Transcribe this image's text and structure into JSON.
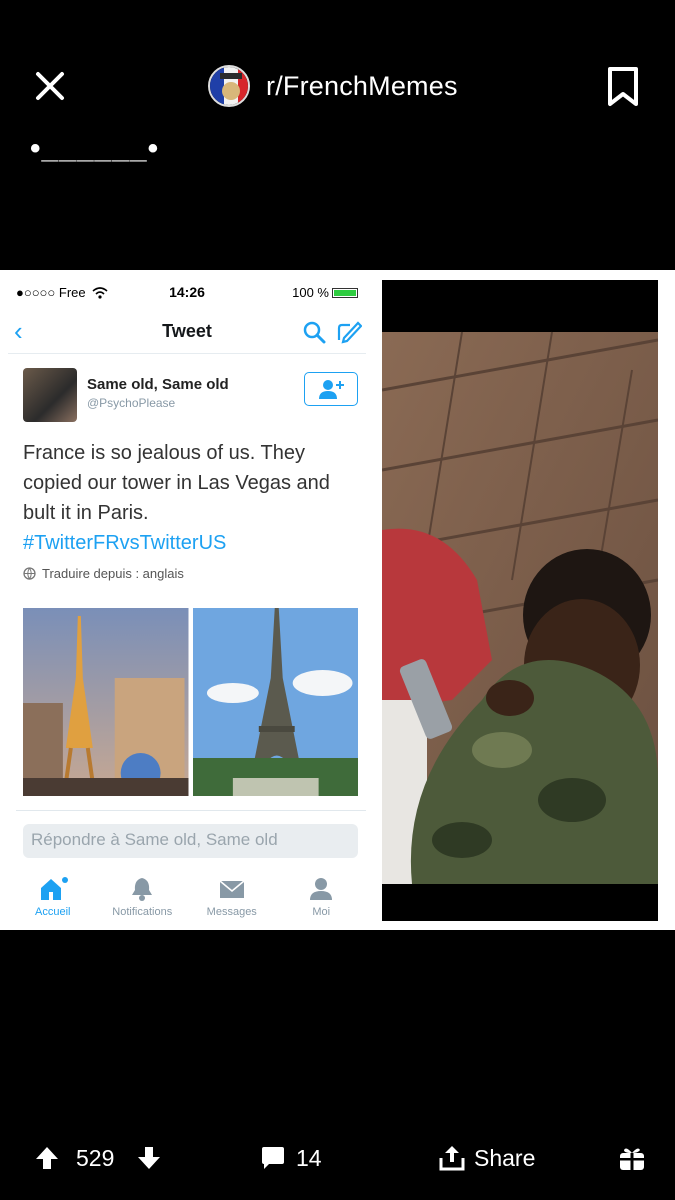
{
  "header": {
    "subreddit": "r/FrenchMemes",
    "post_title": "•______•"
  },
  "tweet": {
    "status_bar": {
      "carrier": "●○○○○ Free",
      "time": "14:26",
      "battery": "100 %"
    },
    "nav_title": "Tweet",
    "author_name": "Same old, Same old",
    "author_handle": "@PsychoPlease",
    "text": "France is so jealous of us. They copied our tower in Las Vegas and bult it in Paris.",
    "hashtag": "#TwitterFRvsTwitterUS",
    "translate": "Traduire depuis : anglais",
    "reply_placeholder": "Répondre à Same old, Same old",
    "tabs": [
      {
        "label": "Accueil",
        "icon": "home-icon",
        "active": true
      },
      {
        "label": "Notifications",
        "icon": "bell-icon",
        "active": false
      },
      {
        "label": "Messages",
        "icon": "envelope-icon",
        "active": false
      },
      {
        "label": "Moi",
        "icon": "person-icon",
        "active": false
      }
    ],
    "accent_color": "#1da1f2"
  },
  "footer": {
    "score": "529",
    "comments": "14",
    "share_label": "Share"
  }
}
